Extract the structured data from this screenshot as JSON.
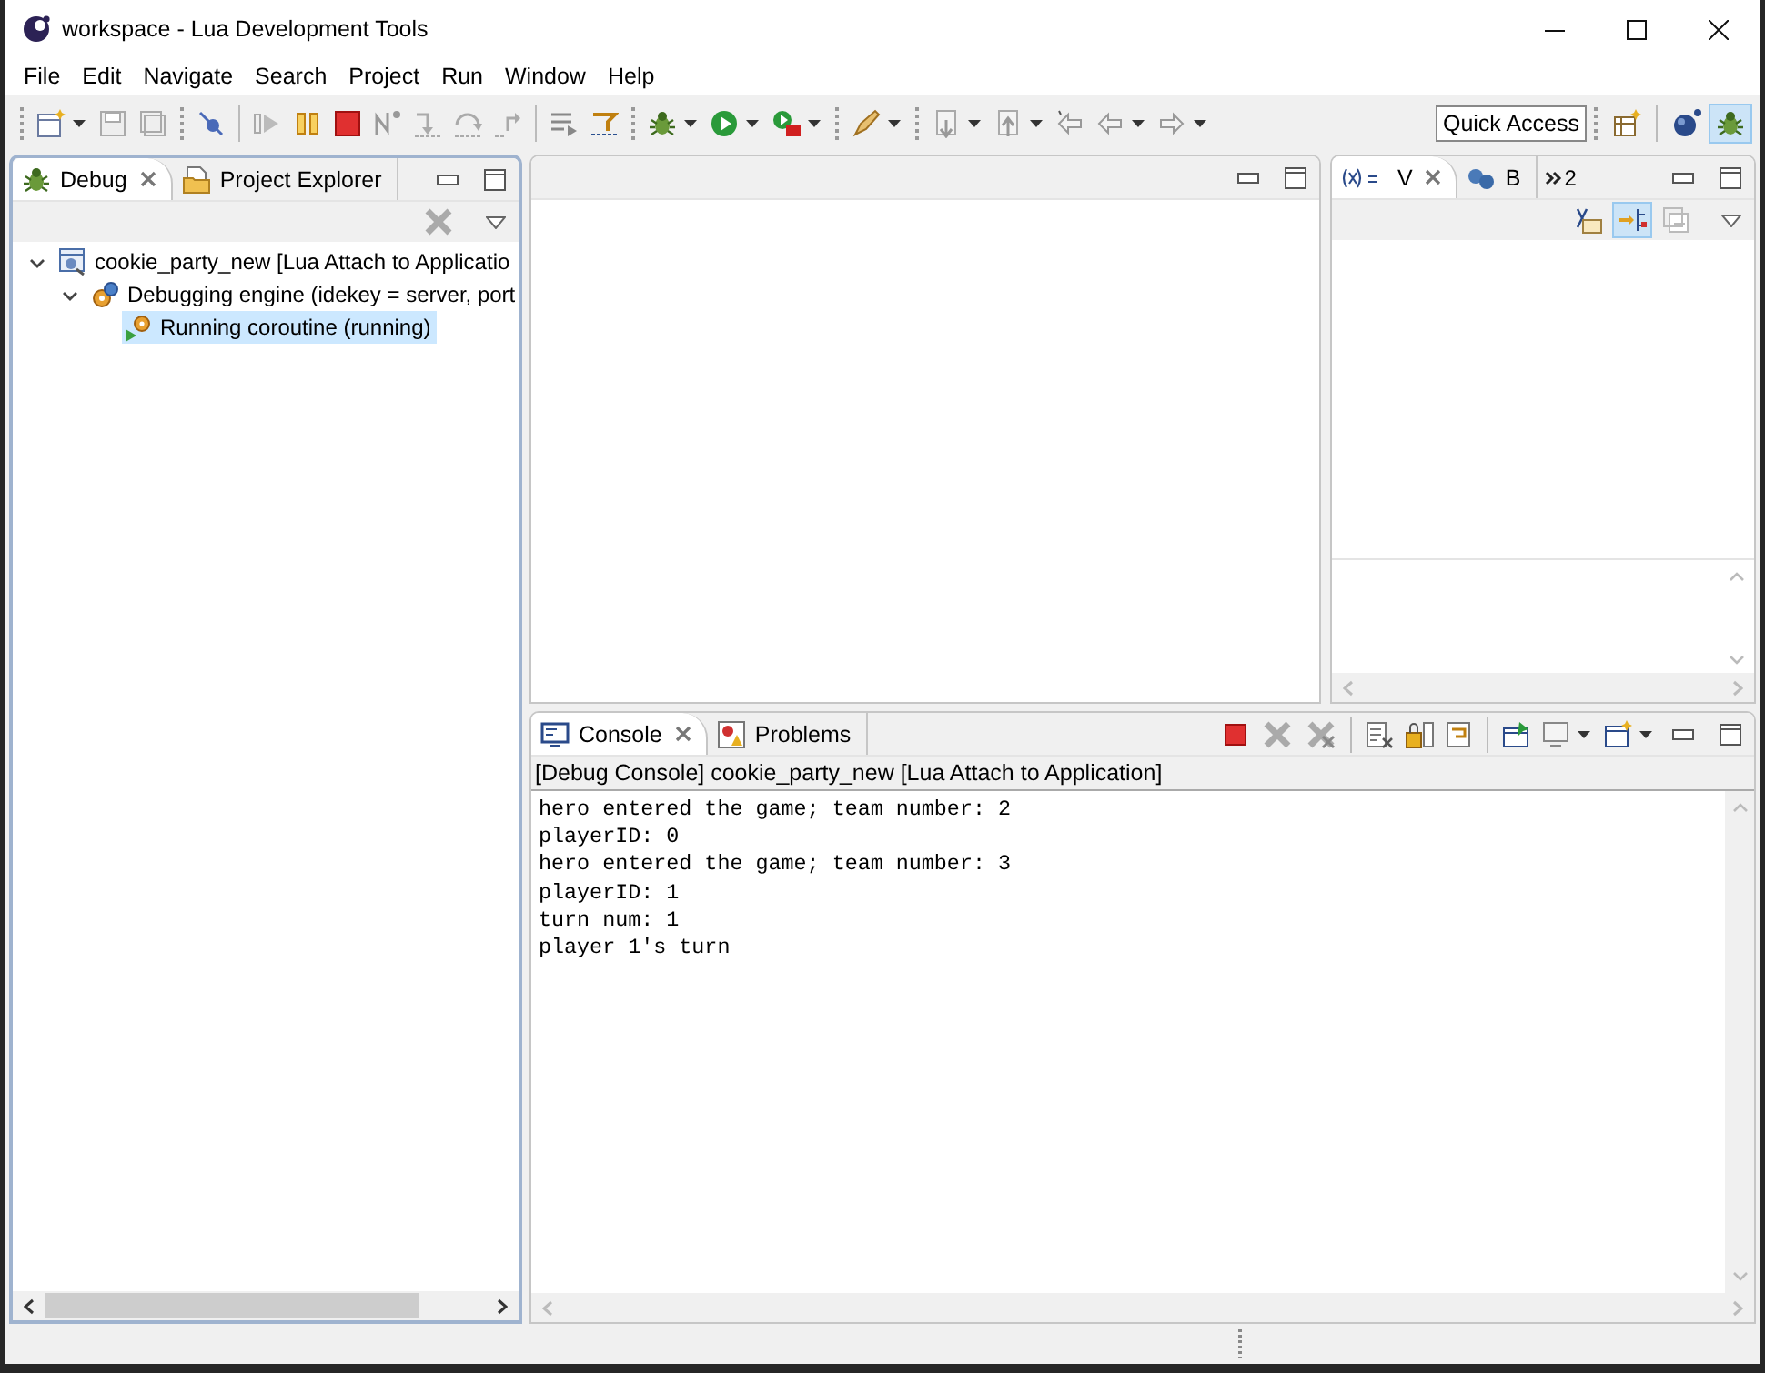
{
  "window": {
    "title": "workspace - Lua Development Tools"
  },
  "menu": [
    "File",
    "Edit",
    "Navigate",
    "Search",
    "Project",
    "Run",
    "Window",
    "Help"
  ],
  "toolbar": {
    "quick_access": "Quick Access",
    "perspectives": [
      {
        "kind": "open",
        "selected": false
      },
      {
        "kind": "lua",
        "selected": false
      },
      {
        "kind": "debug",
        "selected": true
      }
    ]
  },
  "debug_view": {
    "tabs": [
      {
        "label": "Debug",
        "kind": "debug",
        "selected": true
      },
      {
        "label": "Project Explorer",
        "kind": "explorer",
        "selected": false
      }
    ],
    "tree": [
      {
        "label": "cookie_party_new [Lua Attach to Applicatio",
        "kind": "launch",
        "expanded": true,
        "selected": false,
        "children": [
          {
            "label": "Debugging engine (idekey = server, port",
            "kind": "engine",
            "expanded": true,
            "selected": false,
            "children": [
              {
                "label": "Running coroutine (running)",
                "kind": "thread",
                "selected": true
              }
            ]
          }
        ]
      }
    ]
  },
  "variables_view": {
    "tabs": [
      {
        "label": "V",
        "kind": "variables",
        "selected": true
      },
      {
        "label": "B",
        "kind": "breakpoints",
        "selected": false
      }
    ],
    "overflow_count": "2",
    "toolbar": [
      {
        "kind": "type-names",
        "on": false
      },
      {
        "kind": "logical-structure",
        "on": true
      },
      {
        "kind": "collapse-all",
        "on": false
      }
    ]
  },
  "console_view": {
    "tabs": [
      {
        "label": "Console",
        "kind": "console",
        "selected": true
      },
      {
        "label": "Problems",
        "kind": "problems",
        "selected": false
      }
    ],
    "header": "[Debug Console] cookie_party_new [Lua Attach to Application]",
    "lines": [
      "hero entered the game; team number: 2",
      "playerID: 0",
      "hero entered the game; team number: 3",
      "playerID: 1",
      "turn num: 1",
      "player 1's turn"
    ]
  }
}
